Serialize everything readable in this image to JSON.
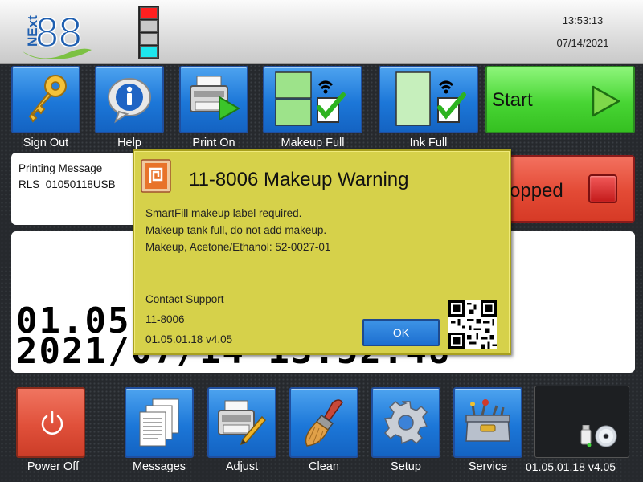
{
  "header": {
    "logo_text": "NEXT 88",
    "time": "13:53:13",
    "date": "07/14/2021",
    "status_lights": [
      "#ff2020",
      "#c8c8c8",
      "#c8c8c8",
      "#1ee6ee"
    ]
  },
  "toolbar": {
    "sign_out": "Sign Out",
    "help": "Help",
    "print_on": "Print On",
    "makeup_full": "Makeup Full",
    "ink_full": "Ink Full",
    "start": "Start"
  },
  "message": {
    "title": "Printing Message",
    "name": "RLS_01050118USB"
  },
  "status": {
    "text": "Stopped",
    "visible_text": "opped",
    "lamp_color": "#d62020"
  },
  "preview": {
    "line1": "01.05",
    "line2": "2021/07/14 13:52:48"
  },
  "dialog": {
    "code_title": "11-8006 Makeup Warning",
    "line1": "SmartFill makeup label required.",
    "line2": "Makeup tank full, do not add makeup.",
    "line3": "Makeup, Acetone/Ethanol: 52-0027-01",
    "contact": "Contact Support",
    "code": "11-8006",
    "version": "01.05.01.18 v4.05",
    "ok": "OK",
    "background_color": "#d6d14a"
  },
  "bottom": {
    "power_off": "Power Off",
    "messages": "Messages",
    "adjust": "Adjust",
    "clean": "Clean",
    "setup": "Setup",
    "service": "Service",
    "version": "01.05.01.18 v4.05"
  },
  "icons": [
    "key-icon",
    "help-info-icon",
    "printer-play-icon",
    "makeup-full-icon",
    "ink-full-icon",
    "play-arrow-icon",
    "warning-icon",
    "power-icon",
    "documents-icon",
    "printer-pencil-icon",
    "brush-icon",
    "gear-icon",
    "toolbox-icon",
    "usb-icon",
    "disc-icon",
    "qr-code-icon"
  ],
  "colors": {
    "accent_blue": "#1c77d8",
    "start_green": "#48d534",
    "stop_red": "#e34a35",
    "dialog_yellow": "#d6d14a"
  }
}
